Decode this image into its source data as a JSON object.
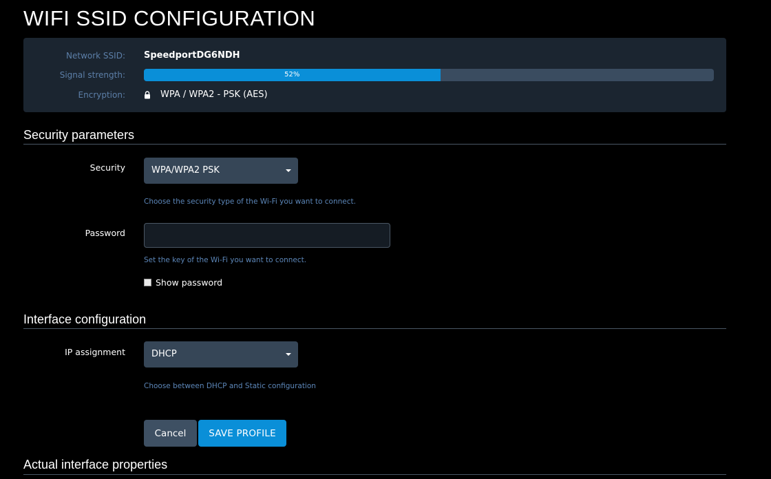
{
  "page": {
    "title": "WIFI SSID CONFIGURATION"
  },
  "network_info": {
    "ssid_label": "Network SSID:",
    "ssid_value": "SpeedportDG6NDH",
    "signal_label": "Signal strength:",
    "signal_percent": 52,
    "signal_text": "52%",
    "encryption_label": "Encryption:",
    "encryption_icon": "lock-icon",
    "encryption_value": "WPA / WPA2 - PSK (AES)"
  },
  "security_section": {
    "title": "Security parameters",
    "security_label": "Security",
    "security_selected": "WPA/WPA2 PSK",
    "security_help": "Choose the security type of the Wi-Fi you want to connect.",
    "password_label": "Password",
    "password_value": "",
    "password_help": "Set the key of the Wi-Fi you want to connect.",
    "show_password_label": "Show password",
    "show_password_checked": false
  },
  "interface_section": {
    "title": "Interface configuration",
    "ip_label": "IP assignment",
    "ip_selected": "DHCP",
    "ip_help": "Choose between DHCP and Static configuration"
  },
  "actions": {
    "cancel_label": "Cancel",
    "save_label": "SAVE PROFILE"
  },
  "properties_section": {
    "title": "Actual interface properties"
  },
  "colors": {
    "accent": "#0a8fd8",
    "panel_bg": "#1b2530",
    "select_bg": "#364657",
    "label_muted": "#5c7fa8"
  }
}
